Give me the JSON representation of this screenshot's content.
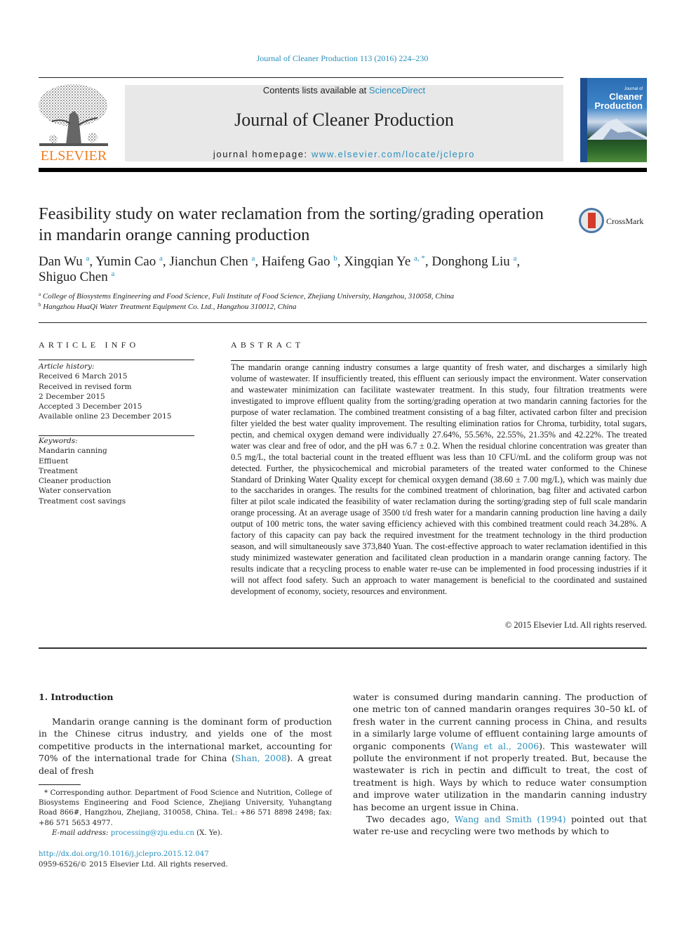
{
  "citation": "Journal of Cleaner Production 113 (2016) 224–230",
  "header": {
    "publisher_logo_text": "ELSEVIER",
    "contents_prefix": "Contents lists available at ",
    "contents_link": "ScienceDirect",
    "journal_name": "Journal of Cleaner Production",
    "homepage_prefix": "journal homepage: ",
    "homepage_link": "www.elsevier.com/locate/jclepro",
    "cover_title_small": "Journal of",
    "cover_title_line1": "Cleaner",
    "cover_title_line2": "Production"
  },
  "article": {
    "title": "Feasibility study on water reclamation from the sorting/grading operation in mandarin orange canning production",
    "crossmark_label": "CrossMark",
    "authors": [
      {
        "name": "Dan Wu",
        "sup": "a",
        "sep": ", "
      },
      {
        "name": "Yumin Cao",
        "sup": "a",
        "sep": ", "
      },
      {
        "name": "Jianchun Chen",
        "sup": "a",
        "sep": ", "
      },
      {
        "name": "Haifeng Gao",
        "sup": "b",
        "sep": ", "
      },
      {
        "name": "Xingqian Ye",
        "sup": "a, *",
        "sep": ", "
      },
      {
        "name": "Donghong Liu",
        "sup": "a",
        "sep": ","
      },
      {
        "name": "Shiguo Chen",
        "sup": "a",
        "sep": ""
      }
    ],
    "affiliations": [
      {
        "mark": "a",
        "text": "College of Biosystems Engineering and Food Science, Fuli Institute of Food Science, Zhejiang University, Hangzhou, 310058, China"
      },
      {
        "mark": "b",
        "text": "Hangzhou HuaQi Water Treatment Equipment Co. Ltd., Hangzhou 310012, China"
      }
    ]
  },
  "article_info": {
    "heading": "ARTICLE INFO",
    "history_label": "Article history:",
    "history": [
      "Received 6 March 2015",
      "Received in revised form",
      "2 December 2015",
      "Accepted 3 December 2015",
      "Available online 23 December 2015"
    ],
    "keywords_label": "Keywords:",
    "keywords": [
      "Mandarin canning",
      "Effluent",
      "Treatment",
      "Cleaner production",
      "Water conservation",
      "Treatment cost savings"
    ]
  },
  "abstract": {
    "heading": "ABSTRACT",
    "text": "The mandarin orange canning industry consumes a large quantity of fresh water, and discharges a similarly high volume of wastewater. If insufficiently treated, this effluent can seriously impact the environment. Water conservation and wastewater minimization can facilitate wastewater treatment. In this study, four filtration treatments were investigated to improve effluent quality from the sorting/grading operation at two mandarin canning factories for the purpose of water reclamation. The combined treatment consisting of a bag filter, activated carbon filter and precision filter yielded the best water quality improvement. The resulting elimination ratios for Chroma, turbidity, total sugars, pectin, and chemical oxygen demand were individually 27.64%, 55.56%, 22.55%, 21.35% and 42.22%. The treated water was clear and free of odor, and the pH was 6.7 ± 0.2. When the residual chlorine concentration was greater than 0.5 mg/L, the total bacterial count in the treated effluent was less than 10 CFU/mL and the coliform group was not detected. Further, the physicochemical and microbial parameters of the treated water conformed to the Chinese Standard of Drinking Water Quality except for chemical oxygen demand (38.60 ± 7.00 mg/L), which was mainly due to the saccharides in oranges. The results for the combined treatment of chlorination, bag filter and activated carbon filter at pilot scale indicated the feasibility of water reclamation during the sorting/grading step of full scale mandarin orange processing. At an average usage of 3500 t/d fresh water for a mandarin canning production line having a daily output of 100 metric tons, the water saving efficiency achieved with this combined treatment could reach 34.28%. A factory of this capacity can pay back the required investment for the treatment technology in the third production season, and will simultaneously save 373,840 Yuan. The cost-effective approach to water reclamation identified in this study minimized wastewater generation and facilitated clean production in a mandarin orange canning factory. The results indicate that a recycling process to enable water re-use can be implemented in food processing industries if it will not affect food safety. Such an approach to water management is beneficial to the coordinated and sustained development of economy, society, resources and environment.",
    "copyright": "© 2015 Elsevier Ltd. All rights reserved."
  },
  "introduction": {
    "heading": "1.  Introduction",
    "p1_a": "Mandarin orange canning is the dominant form of production in the Chinese citrus industry, and yields one of the most competitive products in the international market, accounting for 70% of the international trade for China (",
    "p1_ref": "Shan, 2008",
    "p1_b": "). A great deal of fresh water is consumed during mandarin canning. The production of one metric ton of canned mandarin oranges requires 30–50 kL of fresh water in the current canning process in China, and results in a similarly large volume of effluent containing large amounts of organic components (",
    "p1_ref2": "Wang et al., 2006",
    "p1_c": "). This wastewater will pollute the environment if not properly treated. But, because the wastewater is rich in pectin and difficult to treat, the cost of treatment is high. Ways by which to reduce water consumption and improve water utilization in the mandarin canning industry has become an urgent issue in China.",
    "left_col_text": "Mandarin orange canning is the dominant form of production in the Chinese citrus industry, and yields one of the most competitive products in the international market, accounting for 70% of the international trade for China (",
    "left_col_ref": "Shan, 2008",
    "left_col_tail": "). A great deal of fresh",
    "right_col_head": "water is consumed during mandarin canning. The production of one metric ton of canned mandarin oranges requires 30–50 kL of fresh water in the current canning process in China, and results in a similarly large volume of effluent containing large amounts of organic components (",
    "right_col_ref": "Wang et al., 2006",
    "right_col_mid": "). This wastewater will pollute the environment if not properly treated. But, because the wastewater is rich in pectin and difficult to treat, the cost of treatment is high. Ways by which to reduce water consumption and improve water utilization in the mandarin canning industry has become an urgent issue in China.",
    "p2_prefix": "Two decades ago, ",
    "p2_ref": "Wang and Smith (1994)",
    "p2_suffix": " pointed out that water re-use and recycling were two methods by which to"
  },
  "footnotes": {
    "corresponding": "* Corresponding author. Department of Food Science and Nutrition, College of Biosystems Engineering and Food Science, Zhejiang University, Yuhangtang Road 866#, Hangzhou, Zhejiang, 310058, China. Tel.: +86 571 8898 2498; fax: +86 571 5653 4977.",
    "email_label": "E-mail address: ",
    "email": "processing@zju.edu.cn",
    "email_suffix": " (X. Ye).",
    "doi": "http://dx.doi.org/10.1016/j.jclepro.2015.12.047",
    "issn": "0959-6526/© 2015 Elsevier Ltd. All rights reserved."
  },
  "colors": {
    "link": "#2a8fbd",
    "elsevier_orange": "#f07f22",
    "header_box": "#e8e8e8"
  }
}
